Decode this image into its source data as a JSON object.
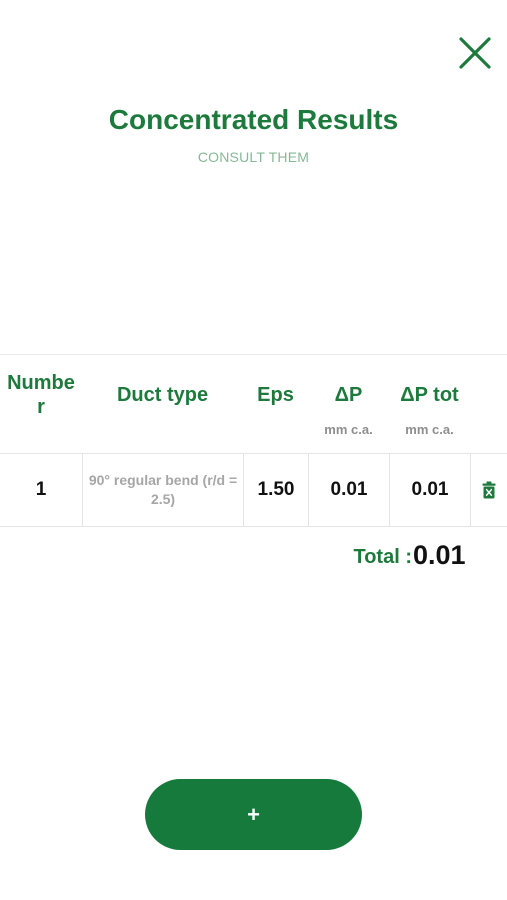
{
  "header": {
    "title": "Concentrated Results",
    "subtitle": "CONSULT THEM",
    "close_icon": "close-icon"
  },
  "table": {
    "columns": [
      {
        "label": "Numbe r",
        "label_lines": [
          "Numbe",
          "r"
        ],
        "unit": ""
      },
      {
        "label": "Duct type",
        "unit": ""
      },
      {
        "label": "Eps",
        "unit": ""
      },
      {
        "label": "ΔP",
        "unit": "mm c.a."
      },
      {
        "label": "ΔP tot",
        "unit": "mm c.a."
      }
    ],
    "rows": [
      {
        "number": "1",
        "duct_type": "90° regular bend (r/d = 2.5)",
        "eps": "1.50",
        "dp": "0.01",
        "dp_tot": "0.01",
        "delete_icon": "trash-icon"
      }
    ]
  },
  "total": {
    "label": "Total :",
    "value": "0.01"
  },
  "add_button": {
    "label": "+"
  },
  "colors": {
    "accent": "#1d7a3c",
    "button": "#157a3b",
    "subtitle": "#86b896",
    "muted": "#a6a6a6"
  }
}
